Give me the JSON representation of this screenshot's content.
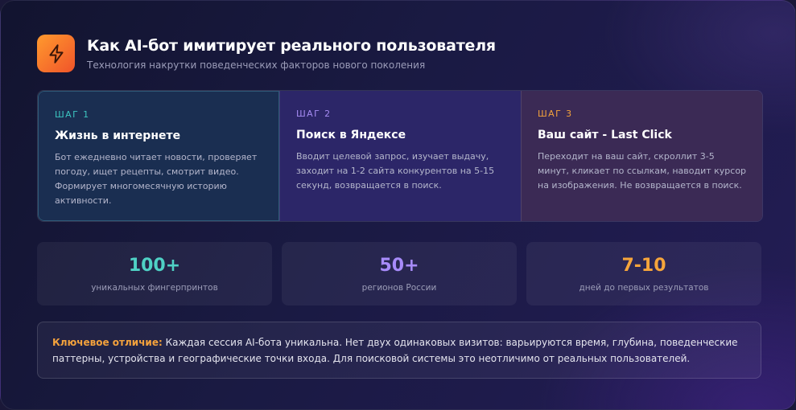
{
  "header": {
    "title": "Как AI-бот имитирует реального пользователя",
    "subtitle": "Технология накрутки поведенческих факторов нового поколения",
    "logo_icon": "lightning-bolt-icon"
  },
  "steps": [
    {
      "step": "ШАГ 1",
      "title": "Жизнь в интернете",
      "description": "Бот ежедневно читает новости, проверяет погоду, ищет рецепты, смотрит видео. Формирует многомесячную историю активности."
    },
    {
      "step": "ШАГ 2",
      "title": "Поиск в Яндексе",
      "description": "Вводит целевой запрос, изучает выдачу, заходит на 1-2 сайта конкурентов на 5-15 секунд, возвращается в поиск."
    },
    {
      "step": "ШАГ 3",
      "title": "Ваш сайт - Last Click",
      "description": "Переходит на ваш сайт, скроллит 3-5 минут, кликает по ссылкам, наводит курсор на изображения. Не возвращается в поиск."
    }
  ],
  "stats": [
    {
      "value": "100+",
      "label": "уникальных фингерпринтов",
      "color": "#4fd1c5"
    },
    {
      "value": "50+",
      "label": "регионов России",
      "color": "#a78bfa"
    },
    {
      "value": "7-10",
      "label": "дней до первых результатов",
      "color": "#f6a53b"
    }
  ],
  "note": {
    "key": "Ключевое отличие:",
    "text": " Каждая сессия AI-бота уникальна. Нет двух одинаковых визитов: варьируются время, глубина, поведенческие паттерны, устройства и географические точки входа. Для поисковой системы это неотличимо от реальных пользователей."
  },
  "colors": {
    "accent_orange": "#f4a23c",
    "accent_teal": "#3cc5c0",
    "accent_purple": "#a58bf2"
  }
}
